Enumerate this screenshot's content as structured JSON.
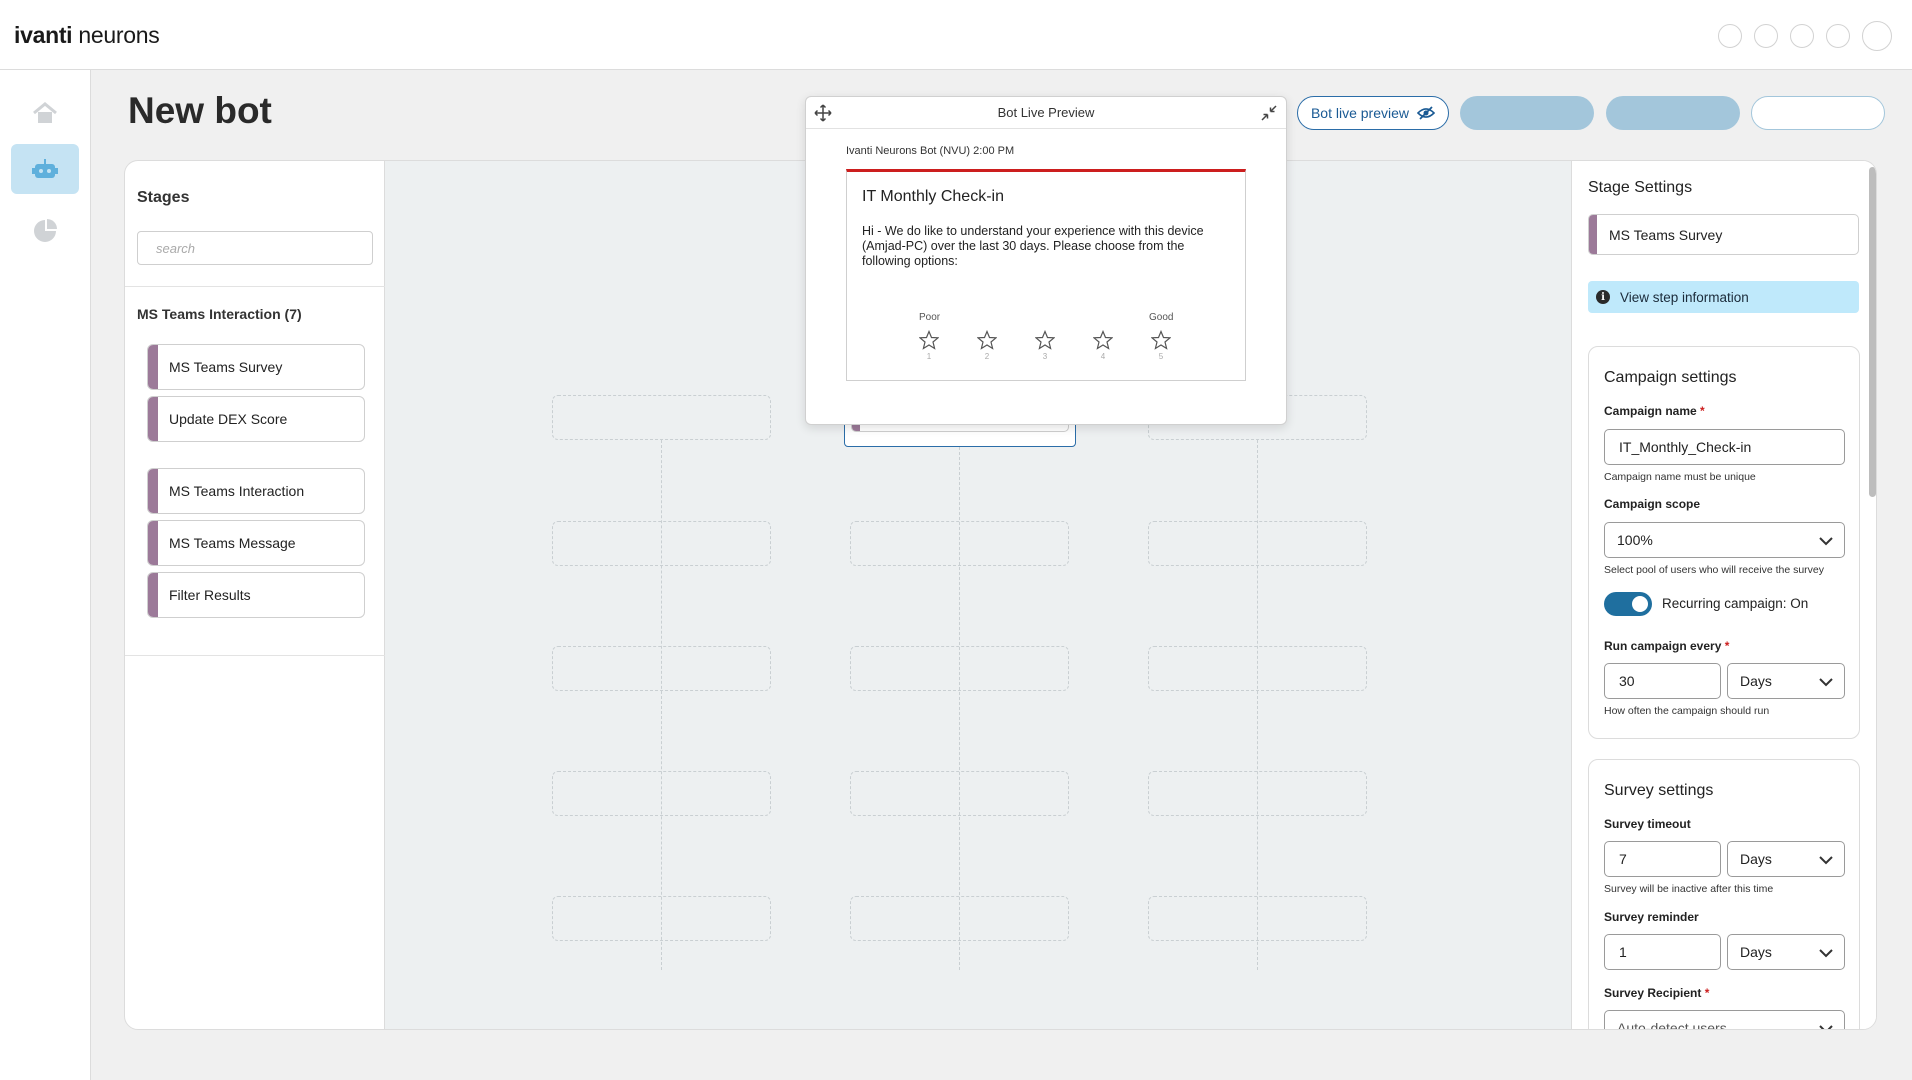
{
  "brand": {
    "logo_bold": "ivanti",
    "logo_light": " neurons"
  },
  "header": {
    "title": "New bot",
    "preview_button_label": "Bot live preview"
  },
  "nav": {
    "items": [
      "home-icon",
      "bot-icon",
      "analytics-icon"
    ],
    "active": "bot-icon"
  },
  "stages": {
    "title": "Stages",
    "search_placeholder": "search",
    "group_label": "MS Teams Interaction (7)",
    "items": [
      "MS Teams Survey",
      "Update DEX Score",
      "MS Teams Interaction",
      "MS Teams Message",
      "Filter Results"
    ]
  },
  "preview": {
    "title": "Bot Live Preview",
    "meta": "Ivanti Neurons Bot (NVU) 2:00 PM",
    "card_title": "IT Monthly Check-in",
    "card_body": "Hi - We do like to understand your experience with this device (Amjad-PC) over the last 30 days. Please choose from the following options:",
    "rating_low": "Poor",
    "rating_high": "Good",
    "star_numbers": [
      "1",
      "2",
      "3",
      "4",
      "5"
    ]
  },
  "settings": {
    "title": "Stage Settings",
    "stage_selected": "MS Teams Survey",
    "info_label": "View step information",
    "campaign": {
      "title": "Campaign settings",
      "name_label": "Campaign name",
      "name_value": "IT_Monthly_Check-in",
      "name_help": "Campaign name must be unique",
      "scope_label": "Campaign scope",
      "scope_value": "100%",
      "scope_help": "Select pool of users who will receive the survey",
      "recurring_label": "Recurring campaign: On",
      "run_every_label": "Run campaign every",
      "run_every_value": "30",
      "run_every_unit": "Days",
      "run_every_help": "How often the campaign should run"
    },
    "survey": {
      "title": "Survey settings",
      "timeout_label": "Survey timeout",
      "timeout_value": "7",
      "timeout_unit": "Days",
      "timeout_help": "Survey will be inactive after this time",
      "reminder_label": "Survey reminder",
      "reminder_value": "1",
      "reminder_unit": "Days",
      "recipient_label": "Survey Recipient",
      "recipient_value": "Auto-detect users"
    },
    "required_mark": "*"
  },
  "colors": {
    "accent": "#2b6da8",
    "stage_marker": "#9c7a99",
    "preview_stripe": "#cc1e1e",
    "info_bg": "#bfe9fb",
    "toggle_on": "#1f6f9f"
  }
}
